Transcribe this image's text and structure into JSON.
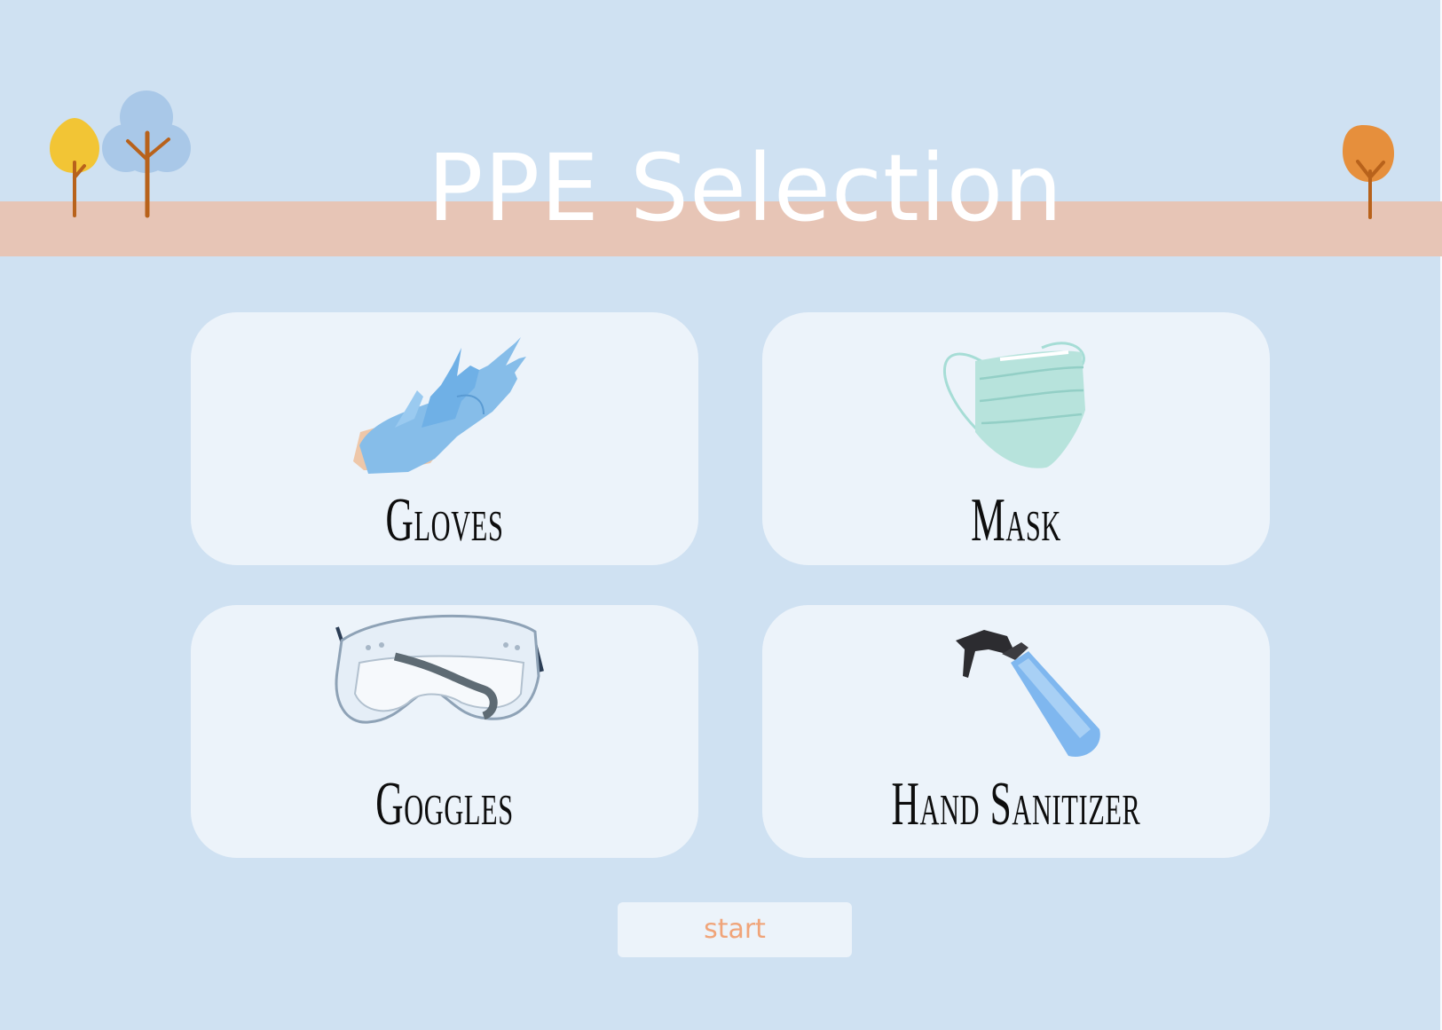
{
  "page": {
    "title": "PPE Selection"
  },
  "colors": {
    "background": "#cfe1f2",
    "band": "#e7c5b6",
    "card": "#ecf3fa",
    "start_text": "#f0a479",
    "tree_yellow": "#f2c535",
    "tree_blue": "#a9c8e8",
    "tree_orange": "#e68f3c",
    "trunk": "#b8621b"
  },
  "items": [
    {
      "label": "Gloves",
      "icon": "gloves-icon"
    },
    {
      "label": "Mask",
      "icon": "mask-icon"
    },
    {
      "label": "Goggles",
      "icon": "goggles-icon"
    },
    {
      "label": "Hand Sanitizer",
      "icon": "spray-bottle-icon"
    }
  ],
  "start_button": {
    "label": "start"
  }
}
